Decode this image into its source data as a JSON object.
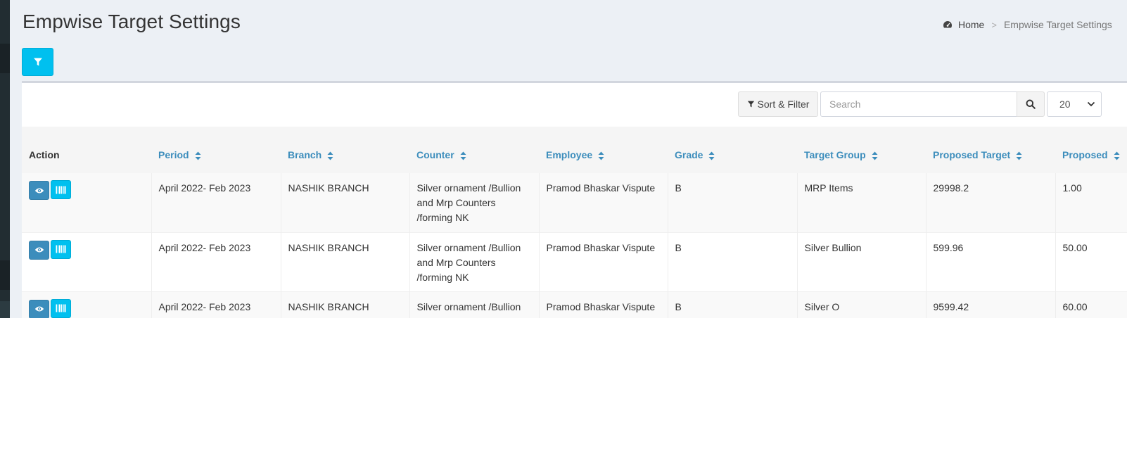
{
  "page": {
    "title": "Empwise Target Settings"
  },
  "breadcrumb": {
    "home_label": "Home",
    "separator": ">",
    "current_label": "Empwise Target Settings"
  },
  "toolbar": {
    "sort_filter_label": "Sort & Filter",
    "search_placeholder": "Search",
    "page_size_value": "20"
  },
  "table": {
    "columns": [
      {
        "label": "Action",
        "sortable": false
      },
      {
        "label": "Period",
        "sortable": true
      },
      {
        "label": "Branch",
        "sortable": true
      },
      {
        "label": "Counter",
        "sortable": true
      },
      {
        "label": "Employee",
        "sortable": true
      },
      {
        "label": "Grade",
        "sortable": true
      },
      {
        "label": "Target Group",
        "sortable": true
      },
      {
        "label": "Proposed Target",
        "sortable": true
      },
      {
        "label": "Proposed",
        "sortable": true
      }
    ],
    "rows": [
      {
        "period": "April 2022- Feb 2023",
        "branch": "NASHIK BRANCH",
        "counter": "Silver ornament /Bullion and Mrp Counters /forming NK",
        "employee": "Pramod Bhaskar Vispute",
        "grade": "B",
        "target_group": "MRP Items",
        "proposed_target": "29998.2",
        "proposed": "1.00"
      },
      {
        "period": "April 2022- Feb 2023",
        "branch": "NASHIK BRANCH",
        "counter": "Silver ornament /Bullion and Mrp Counters /forming NK",
        "employee": "Pramod Bhaskar Vispute",
        "grade": "B",
        "target_group": "Silver Bullion",
        "proposed_target": "599.96",
        "proposed": "50.00"
      },
      {
        "period": "April 2022- Feb 2023",
        "branch": "NASHIK BRANCH",
        "counter": "Silver ornament /Bullion and Mrp Counters /forming NK",
        "employee": "Pramod Bhaskar Vispute",
        "grade": "B",
        "target_group": "Silver O",
        "proposed_target": "9599.42",
        "proposed": "60.00"
      }
    ]
  },
  "colors": {
    "accent_info": "#00c0ef",
    "accent_primary": "#3c8dbc",
    "page_background": "#ecf0f5",
    "sidebar": "#222d32"
  },
  "icons": {
    "breadcrumb_home": "dashboard-icon",
    "filter_button": "filter-icon",
    "search_button": "search-icon",
    "row_view": "eye-icon",
    "row_barcode": "barcode-icon",
    "column_sort": "sort-icon"
  }
}
